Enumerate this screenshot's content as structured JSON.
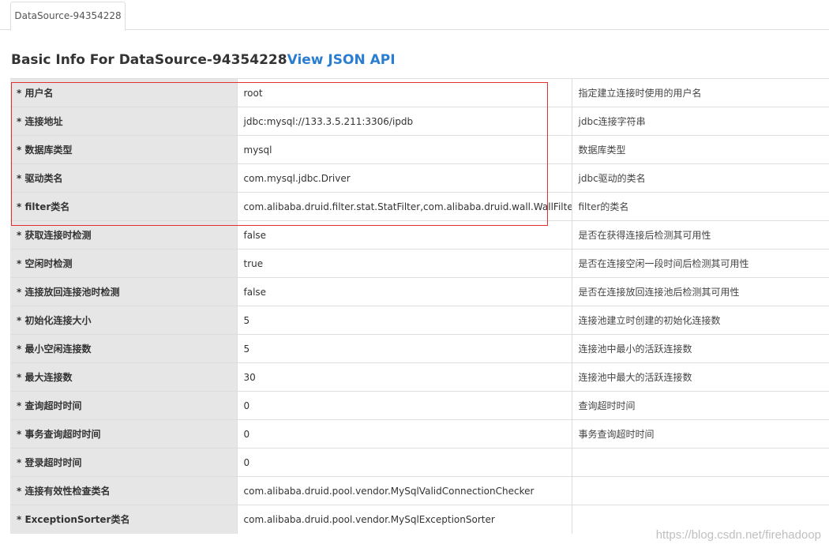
{
  "tabs": [
    {
      "label": "DataSource-94354228"
    }
  ],
  "heading": {
    "title": "Basic Info For DataSource-94354228",
    "link_label": "View JSON API"
  },
  "rows": [
    {
      "name": "* 用户名",
      "value": "root",
      "desc": "指定建立连接时使用的用户名"
    },
    {
      "name": "* 连接地址",
      "value": "jdbc:mysql://133.3.5.211:3306/ipdb",
      "desc": "jdbc连接字符串"
    },
    {
      "name": "* 数据库类型",
      "value": "mysql",
      "desc": "数据库类型"
    },
    {
      "name": "* 驱动类名",
      "value": "com.mysql.jdbc.Driver",
      "desc": "jdbc驱动的类名"
    },
    {
      "name": "* filter类名",
      "value": "com.alibaba.druid.filter.stat.StatFilter,com.alibaba.druid.wall.WallFilter",
      "desc": "filter的类名"
    },
    {
      "name": "* 获取连接时检测",
      "value": "false",
      "desc": "是否在获得连接后检测其可用性"
    },
    {
      "name": "* 空闲时检测",
      "value": "true",
      "desc": "是否在连接空闲一段时间后检测其可用性"
    },
    {
      "name": "* 连接放回连接池时检测",
      "value": "false",
      "desc": "是否在连接放回连接池后检测其可用性"
    },
    {
      "name": "* 初始化连接大小",
      "value": "5",
      "desc": "连接池建立时创建的初始化连接数"
    },
    {
      "name": "* 最小空闲连接数",
      "value": "5",
      "desc": "连接池中最小的活跃连接数"
    },
    {
      "name": "* 最大连接数",
      "value": "30",
      "desc": "连接池中最大的活跃连接数"
    },
    {
      "name": "* 查询超时时间",
      "value": "0",
      "desc": "查询超时时间"
    },
    {
      "name": "* 事务查询超时时间",
      "value": "0",
      "desc": "事务查询超时时间"
    },
    {
      "name": "* 登录超时时间",
      "value": "0",
      "desc": ""
    },
    {
      "name": "* 连接有效性检查类名",
      "value": "com.alibaba.druid.pool.vendor.MySqlValidConnectionChecker",
      "desc": ""
    },
    {
      "name": "* ExceptionSorter类名",
      "value": "com.alibaba.druid.pool.vendor.MySqlExceptionSorter",
      "desc": ""
    }
  ],
  "watermark": "https://blog.csdn.net/firehadoop",
  "colors": {
    "link": "#2a7ed2",
    "highlight_border": "#e03030",
    "name_column_bg": "#e6e6e6"
  }
}
